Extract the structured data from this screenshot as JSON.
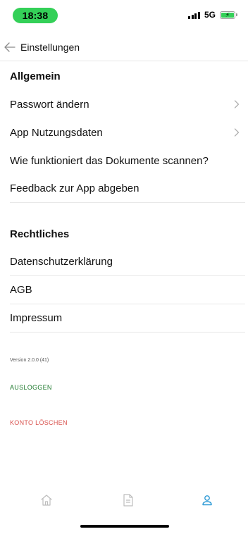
{
  "status": {
    "time": "18:38",
    "network": "5G",
    "battery_bolt": "⚡"
  },
  "header": {
    "title": "Einstellungen"
  },
  "sections": {
    "general": {
      "title": "Allgemein",
      "items": [
        {
          "label": "Passwort ändern",
          "chevron": true
        },
        {
          "label": "App Nutzungsdaten",
          "chevron": true
        },
        {
          "label": "Wie funktioniert das Dokumente scannen?"
        },
        {
          "label": "Feedback zur App abgeben"
        }
      ]
    },
    "legal": {
      "title": "Rechtliches",
      "items": [
        {
          "label": "Datenschutzerklärung"
        },
        {
          "label": "AGB"
        },
        {
          "label": "Impressum"
        }
      ]
    }
  },
  "footer": {
    "version": "Version 2.0.0 (41)",
    "logout": "AUSLOGGEN",
    "delete": "KONTO LÖSCHEN"
  },
  "tabs": {
    "home": "home-icon",
    "documents": "document-icon",
    "profile": "profile-icon",
    "active": "profile"
  },
  "colors": {
    "accent": "#2f9bd6",
    "logout": "#1f7a2e",
    "delete": "#d9534f",
    "time_pill": "#34d058"
  }
}
